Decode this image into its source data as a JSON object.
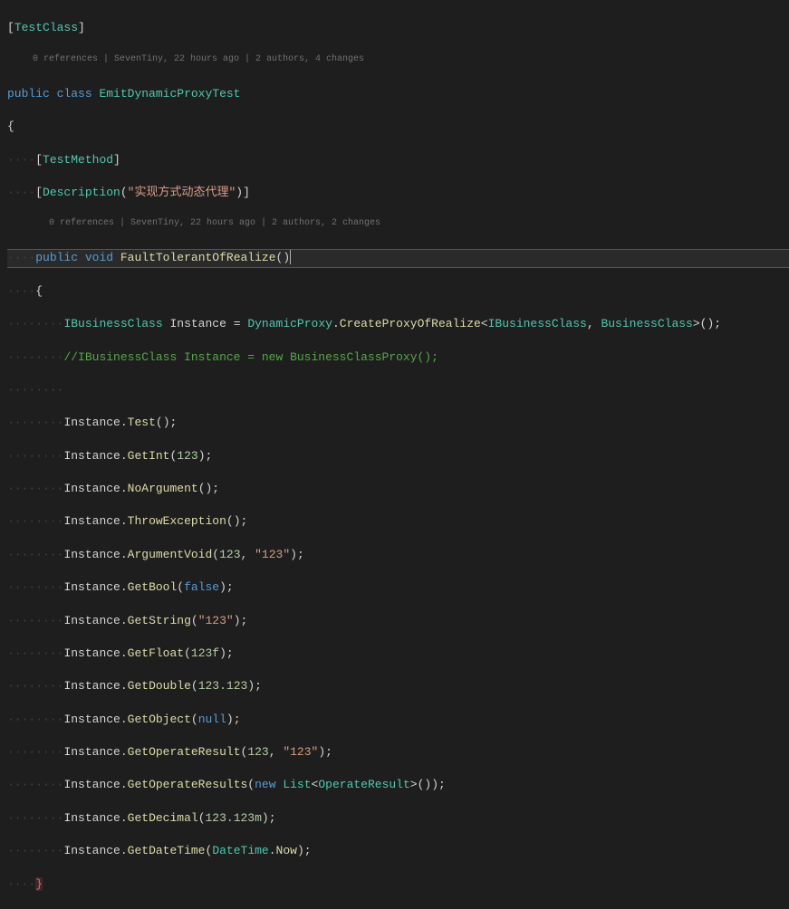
{
  "codelens1": "0 references | SevenTiny, 22 hours ago | 2 authors, 4 changes",
  "codelens2": "0 references | SevenTiny, 22 hours ago | 2 authors, 2 changes",
  "attr": {
    "testClass": "TestClass",
    "testMethod": "TestMethod",
    "description": "Description"
  },
  "descStr": "\"实现方式动态代理\"",
  "kw": {
    "public": "public",
    "class": "class",
    "void": "void",
    "new": "new",
    "false": "false",
    "null": "null"
  },
  "types": {
    "EmitDynamicProxyTest": "EmitDynamicProxyTest",
    "IBusinessClass": "IBusinessClass",
    "DynamicProxy": "DynamicProxy",
    "BusinessClass": "BusinessClass",
    "List": "List",
    "OperateResult": "OperateResult",
    "DateTime": "DateTime"
  },
  "methods": {
    "FaultTolerantOfRealize": "FaultTolerantOfRealize",
    "CreateProxyOfRealize": "CreateProxyOfRealize",
    "Test": "Test",
    "GetInt": "GetInt",
    "NoArgument": "NoArgument",
    "ThrowException": "ThrowException",
    "ArgumentVoid": "ArgumentVoid",
    "GetBool": "GetBool",
    "GetString": "GetString",
    "GetFloat": "GetFloat",
    "GetDouble": "GetDouble",
    "GetObject": "GetObject",
    "GetOperateResult": "GetOperateResult",
    "GetOperateResults": "GetOperateResults",
    "GetDecimal": "GetDecimal",
    "GetDateTime": "GetDateTime",
    "Now": "Now"
  },
  "vars": {
    "Instance": "Instance"
  },
  "nums": {
    "i123": "123",
    "f123": "123f",
    "d123": "123.123",
    "m123": "123.123m"
  },
  "strs": {
    "s123": "\"123\""
  },
  "comment": "//IBusinessClass Instance = new BusinessClassProxy();"
}
